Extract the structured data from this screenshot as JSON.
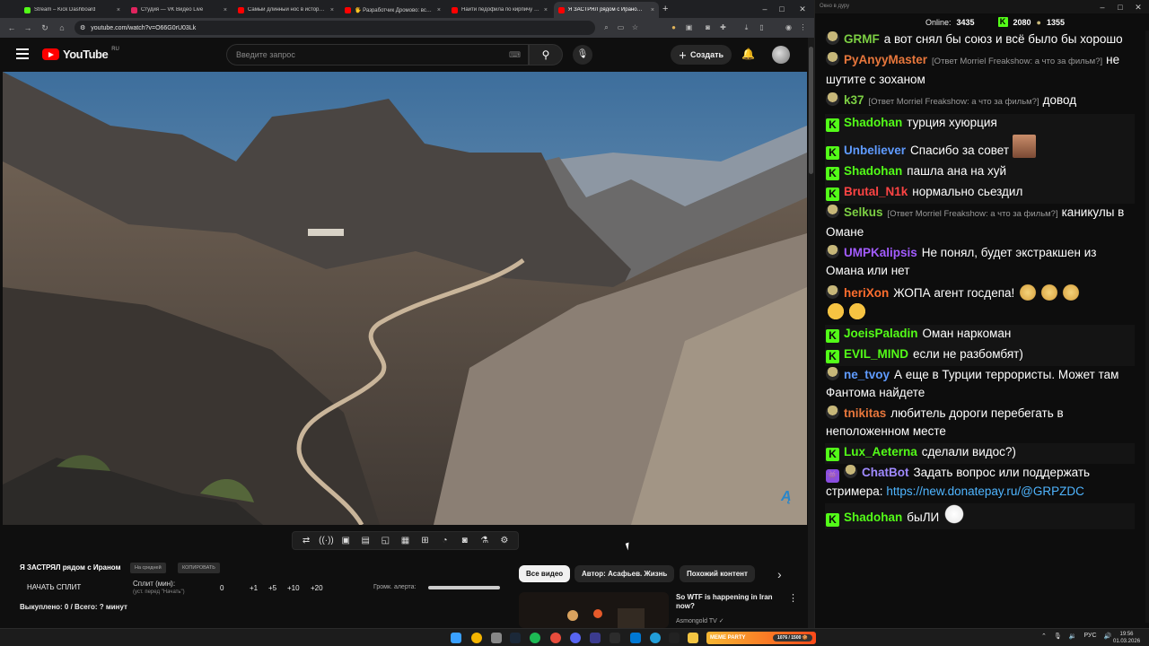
{
  "browser": {
    "tabs": [
      {
        "label": "Stream – Kick Dashboard",
        "color": "#53fc18"
      },
      {
        "label": "Студия — VK Видео Live",
        "color": "#e0245e"
      },
      {
        "label": "Самый длинный нос в истори…",
        "color": "#ff0000"
      },
      {
        "label": "🖐 Разработчик Дромово: все…",
        "color": "#ff0000"
      },
      {
        "label": "Найти педофила по кирпичу (…",
        "color": "#ff0000"
      },
      {
        "label": "Я ЗАСТРЯЛ рядом с Ирано…",
        "color": "#ff0000"
      }
    ],
    "url": "youtube.com/watch?v=O66G0rU03Lk"
  },
  "youtube": {
    "logo_text": "YouTube",
    "region": "RU",
    "search_placeholder": "Введите запрос",
    "create_label": "Создать",
    "video_title": "Я ЗАСТРЯЛ рядом с Ираном",
    "tag_1": "На средней",
    "tag_2": "КОПИРОВАТЬ",
    "split": {
      "start_label": "НАЧАТЬ СПЛИТ",
      "split_label": "Сплит (мин):",
      "split_hint": "(уст. перед \"Начать\")",
      "value": "0",
      "steps": [
        "+1",
        "+5",
        "+10",
        "+20"
      ],
      "volume_label": "Громк. алерта:",
      "bought": "Выкуплено: 0 / Всего: ? минут"
    },
    "chips": [
      "Все видео",
      "Автор: Асафьев. Жизнь",
      "Похожий контент"
    ],
    "rec": {
      "title": "So WTF is happening in Iran now?",
      "channel": "Asmongold TV ✓"
    }
  },
  "chat": {
    "window_title": "Окно в дуру",
    "online_label": "Online:",
    "online": "3435",
    "kick_count": "2080",
    "user_count": "1355",
    "messages": [
      {
        "badge": "u",
        "nick": "GRMF",
        "color": "#7ccf43",
        "reply": "",
        "text": "а вот снял бы союз и всё было бы хорошо",
        "mod": false
      },
      {
        "badge": "u",
        "nick": "PyAnyyMaster",
        "color": "#e8773c",
        "reply": "[Ответ Morriel Freakshow: а что за фильм?]",
        "text": "не шутите с зоханом",
        "mod": false
      },
      {
        "badge": "u",
        "nick": "k37",
        "color": "#7ccf43",
        "reply": "[Ответ Morriel Freakshow: а что за фильм?]",
        "text": "довод",
        "mod": false
      },
      {
        "badge": "k",
        "nick": "Shadohan",
        "color": "#53fc18",
        "reply": "",
        "text": "турция хуюрция",
        "mod": true
      },
      {
        "badge": "k",
        "nick": "Unbeliever",
        "color": "#5f9bff",
        "reply": "",
        "text": "Спасибо за совет",
        "mod": true,
        "emote": "face"
      },
      {
        "badge": "k",
        "nick": "Shadohan",
        "color": "#53fc18",
        "reply": "",
        "text": "пашла ана на хуй",
        "mod": true
      },
      {
        "badge": "k",
        "nick": "Brutal_N1k",
        "color": "#ff4444",
        "reply": "",
        "text": "нормально сьездил",
        "mod": true
      },
      {
        "badge": "u",
        "nick": "Selkus",
        "color": "#7ccf43",
        "reply": "[Ответ Morriel Freakshow: а что за фильм?]",
        "text": "каникулы в Омане",
        "mod": false
      },
      {
        "badge": "u",
        "nick": "UMPKalipsis",
        "color": "#a35cff",
        "reply": "",
        "text": "Не понял, будет экстракшен из Омана или нет",
        "mod": false
      },
      {
        "badge": "u",
        "nick": "heriXon",
        "color": "#ff6e2e",
        "reply": "",
        "text": "ЖОПА агент госдепа!",
        "mod": false,
        "emote": "mixed"
      },
      {
        "badge": "k",
        "nick": "JoeisPaladin",
        "color": "#53fc18",
        "reply": "",
        "text": "Оман наркоман",
        "mod": true
      },
      {
        "badge": "k",
        "nick": "EVIL_MIND",
        "color": "#53fc18",
        "reply": "",
        "text": "если не разбомбят)",
        "mod": true
      },
      {
        "badge": "u",
        "nick": "ne_tvoy",
        "color": "#5f9bff",
        "reply": "",
        "text": "А еще в Турции террористы. Может там Фантома найдете",
        "mod": false
      },
      {
        "badge": "u",
        "nick": "tnikitas",
        "color": "#e8773c",
        "reply": "",
        "text": "любитель дороги перебегать в неположенном месте",
        "mod": false
      },
      {
        "badge": "k",
        "nick": "Lux_Aeterna",
        "color": "#53fc18",
        "reply": "",
        "text": "сделали видос?)",
        "mod": true
      },
      {
        "badge": "bot",
        "nick": "ChatBot",
        "color": "#a08aff",
        "reply": "",
        "text": "Задать вопрос или поддержать стримера:",
        "link": "https://new.donatepay.ru/@GRPZDC",
        "mod": false
      },
      {
        "badge": "k",
        "nick": "Shadohan",
        "color": "#53fc18",
        "reply": "",
        "text": "быЛИ",
        "mod": true,
        "emote": "mask"
      }
    ]
  },
  "taskbar": {
    "widget_label": "MEME PARTY",
    "widget_progress": "1076 / 1500 🍪",
    "lang": "РУС",
    "time": "19:56",
    "date": "01.03.2026"
  }
}
